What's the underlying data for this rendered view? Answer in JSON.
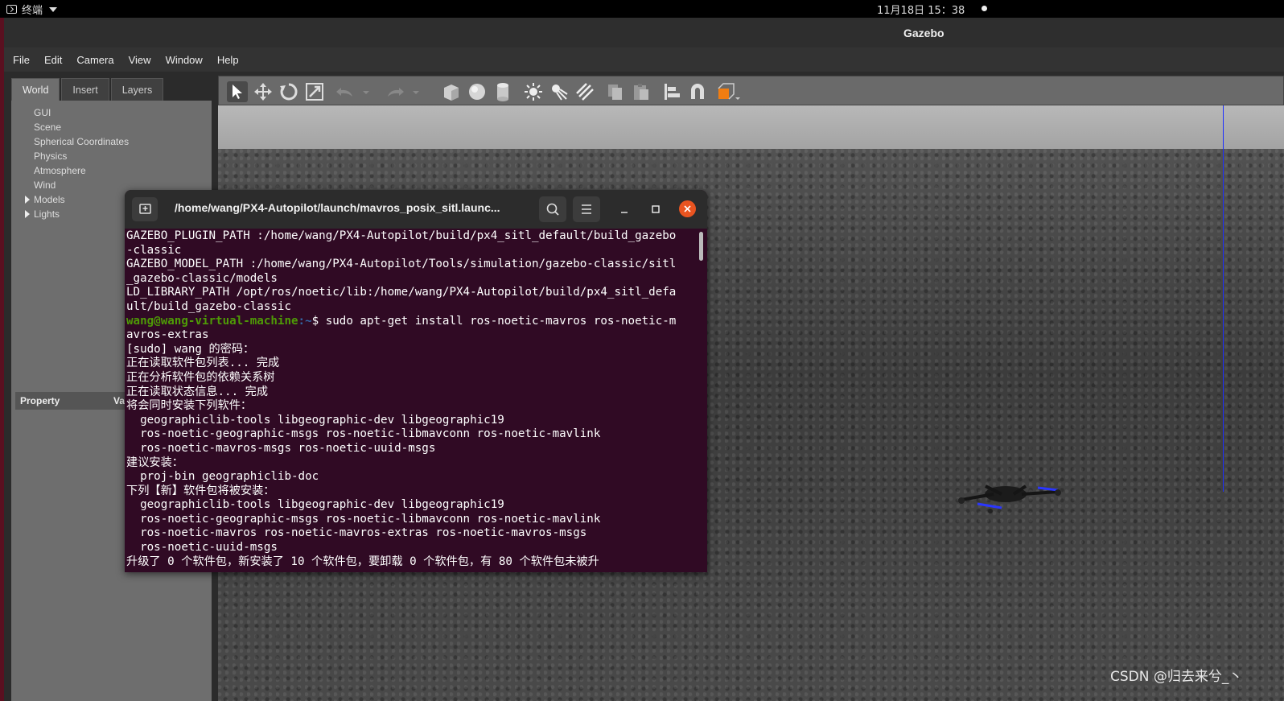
{
  "system_bar": {
    "app_label": "终端",
    "clock": "11月18日 15：38"
  },
  "window": {
    "title": "Gazebo"
  },
  "menu": [
    "File",
    "Edit",
    "Camera",
    "View",
    "Window",
    "Help"
  ],
  "left_panel": {
    "tabs": [
      "World",
      "Insert",
      "Layers"
    ],
    "tree": [
      "GUI",
      "Scene",
      "Spherical Coordinates",
      "Physics",
      "Atmosphere",
      "Wind",
      "Models",
      "Lights"
    ],
    "property_header": {
      "property": "Property",
      "value": "Val"
    }
  },
  "toolbar_icons": [
    "select-icon",
    "translate-icon",
    "rotate-icon",
    "scale-icon",
    "undo-icon",
    "redo-icon",
    "box-icon",
    "sphere-icon",
    "cylinder-icon",
    "point-light-icon",
    "spot-light-icon",
    "directional-light-icon",
    "copy-icon",
    "paste-icon",
    "align-icon",
    "snap-icon",
    "view-angle-icon"
  ],
  "terminal": {
    "title": "/home/wang/PX4-Autopilot/launch/mavros_posix_sitl.launc...",
    "lines": [
      "GAZEBO_PLUGIN_PATH :/home/wang/PX4-Autopilot/build/px4_sitl_default/build_gazebo",
      "-classic",
      "GAZEBO_MODEL_PATH :/home/wang/PX4-Autopilot/Tools/simulation/gazebo-classic/sitl",
      "_gazebo-classic/models",
      "LD_LIBRARY_PATH /opt/ros/noetic/lib:/home/wang/PX4-Autopilot/build/px4_sitl_defa",
      "ult/build_gazebo-classic"
    ],
    "prompt_user": "wang@wang-virtual-machine",
    "prompt_path": ":~",
    "command": "$ sudo apt-get install ros-noetic-mavros ros-noetic-m",
    "lines_after": [
      "avros-extras",
      "[sudo] wang 的密码：",
      "正在读取软件包列表... 完成",
      "正在分析软件包的依赖关系树",
      "正在读取状态信息... 完成",
      "将会同时安装下列软件：",
      "  geographiclib-tools libgeographic-dev libgeographic19",
      "  ros-noetic-geographic-msgs ros-noetic-libmavconn ros-noetic-mavlink",
      "  ros-noetic-mavros-msgs ros-noetic-uuid-msgs",
      "建议安装：",
      "  proj-bin geographiclib-doc",
      "下列【新】软件包将被安装：",
      "  geographiclib-tools libgeographic-dev libgeographic19",
      "  ros-noetic-geographic-msgs ros-noetic-libmavconn ros-noetic-mavlink",
      "  ros-noetic-mavros ros-noetic-mavros-extras ros-noetic-mavros-msgs",
      "  ros-noetic-uuid-msgs",
      "升级了 0 个软件包，新安装了 10 个软件包，要卸载 0 个软件包，有 80 个软件包未被升"
    ]
  },
  "watermark": "CSDN @归去来兮_丶",
  "colors": {
    "terminal_bg": "#300a24",
    "prompt_green": "#4e9a06",
    "close_orange": "#e95420",
    "axis_blue": "#1e2fff"
  }
}
